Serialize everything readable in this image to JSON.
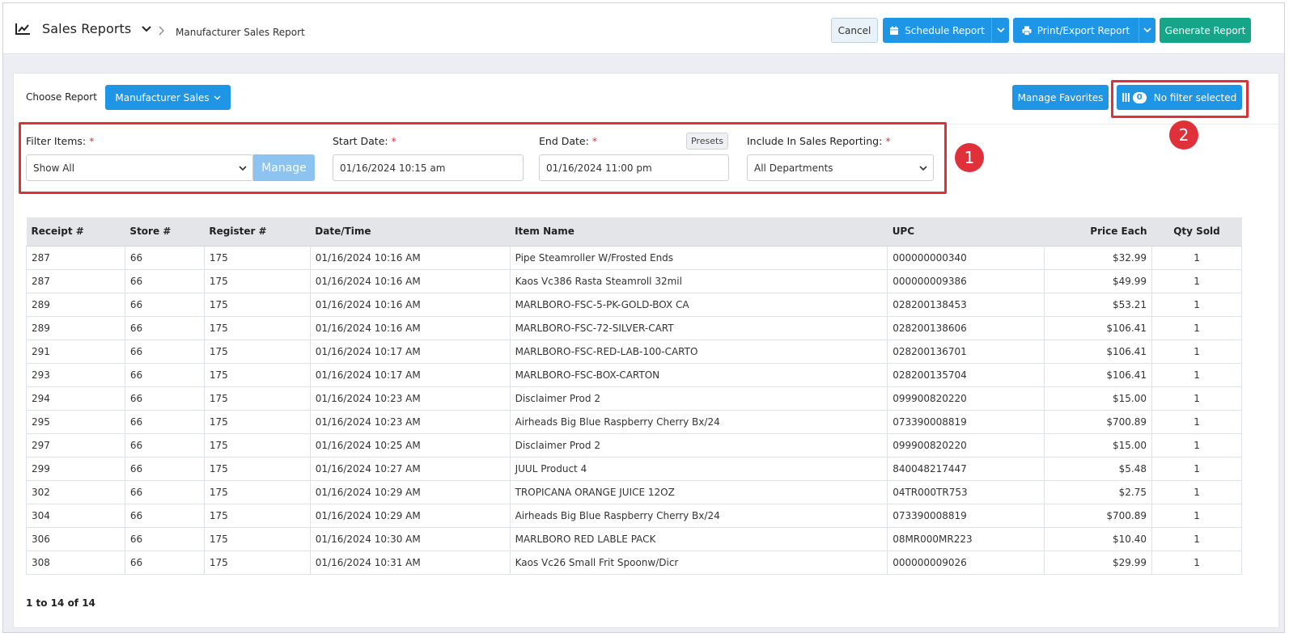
{
  "header": {
    "title": "Sales Reports",
    "breadcrumb": "Manufacturer Sales Report",
    "cancel_label": "Cancel",
    "schedule_label": "Schedule Report",
    "print_label": "Print/Export Report",
    "generate_label": "Generate Report"
  },
  "toolbar": {
    "choose_label": "Choose Report",
    "report_select": "Manufacturer Sales",
    "favorites_label": "Manage Favorites",
    "filter_count": "0",
    "filter_label": "No filter selected"
  },
  "annotations": {
    "one": "1",
    "two": "2"
  },
  "filters": {
    "filter_items_label": "Filter Items:",
    "filter_items_value": "Show All",
    "manage_label": "Manage",
    "start_label": "Start Date:",
    "start_value": "01/16/2024 10:15 am",
    "end_label": "End Date:",
    "end_value": "01/16/2024 11:00 pm",
    "presets_label": "Presets",
    "include_label": "Include In Sales Reporting:",
    "include_value": "All Departments",
    "required_mark": "*"
  },
  "table": {
    "columns": [
      "Receipt #",
      "Store #",
      "Register #",
      "Date/Time",
      "Item Name",
      "UPC",
      "Price Each",
      "Qty Sold"
    ],
    "rows": [
      [
        "287",
        "66",
        "175",
        "01/16/2024 10:16 AM",
        "Pipe Steamroller W/Frosted Ends",
        "000000000340",
        "$32.99",
        "1"
      ],
      [
        "287",
        "66",
        "175",
        "01/16/2024 10:16 AM",
        "Kaos Vc386 Rasta Steamroll 32mil",
        "000000009386",
        "$49.99",
        "1"
      ],
      [
        "289",
        "66",
        "175",
        "01/16/2024 10:16 AM",
        "MARLBORO-FSC-5-PK-GOLD-BOX CA",
        "028200138453",
        "$53.21",
        "1"
      ],
      [
        "289",
        "66",
        "175",
        "01/16/2024 10:16 AM",
        "MARLBORO-FSC-72-SILVER-CART",
        "028200138606",
        "$106.41",
        "1"
      ],
      [
        "291",
        "66",
        "175",
        "01/16/2024 10:17 AM",
        "MARLBORO-FSC-RED-LAB-100-CARTO",
        "028200136701",
        "$106.41",
        "1"
      ],
      [
        "293",
        "66",
        "175",
        "01/16/2024 10:17 AM",
        "MARLBORO-FSC-BOX-CARTON",
        "028200135704",
        "$106.41",
        "1"
      ],
      [
        "294",
        "66",
        "175",
        "01/16/2024 10:23 AM",
        "Disclaimer Prod 2",
        "099900820220",
        "$15.00",
        "1"
      ],
      [
        "295",
        "66",
        "175",
        "01/16/2024 10:23 AM",
        "Airheads Big Blue Raspberry Cherry Bx/24",
        "073390008819",
        "$700.89",
        "1"
      ],
      [
        "297",
        "66",
        "175",
        "01/16/2024 10:25 AM",
        "Disclaimer Prod 2",
        "099900820220",
        "$15.00",
        "1"
      ],
      [
        "299",
        "66",
        "175",
        "01/16/2024 10:27 AM",
        "JUUL Product 4",
        "840048217447",
        "$5.48",
        "1"
      ],
      [
        "302",
        "66",
        "175",
        "01/16/2024 10:29 AM",
        "TROPICANA ORANGE JUICE 12OZ",
        "04TR000TR753",
        "$2.75",
        "1"
      ],
      [
        "304",
        "66",
        "175",
        "01/16/2024 10:29 AM",
        "Airheads Big Blue Raspberry Cherry Bx/24",
        "073390008819",
        "$700.89",
        "1"
      ],
      [
        "306",
        "66",
        "175",
        "01/16/2024 10:30 AM",
        "MARLBORO RED LABLE PACK",
        "08MR000MR223",
        "$10.40",
        "1"
      ],
      [
        "308",
        "66",
        "175",
        "01/16/2024 10:31 AM",
        "Kaos Vc26 Small Frit Spoonw/Dicr",
        "000000009026",
        "$29.99",
        "1"
      ]
    ],
    "footer": "1 to 14 of 14"
  },
  "colors": {
    "primary": "#1f95e6",
    "success": "#17a589",
    "annotation": "#e0303a"
  },
  "icons": [
    "line-chart-icon",
    "chevron-down-icon",
    "chevron-right-icon",
    "calendar-icon",
    "printer-icon",
    "columns-icon"
  ]
}
